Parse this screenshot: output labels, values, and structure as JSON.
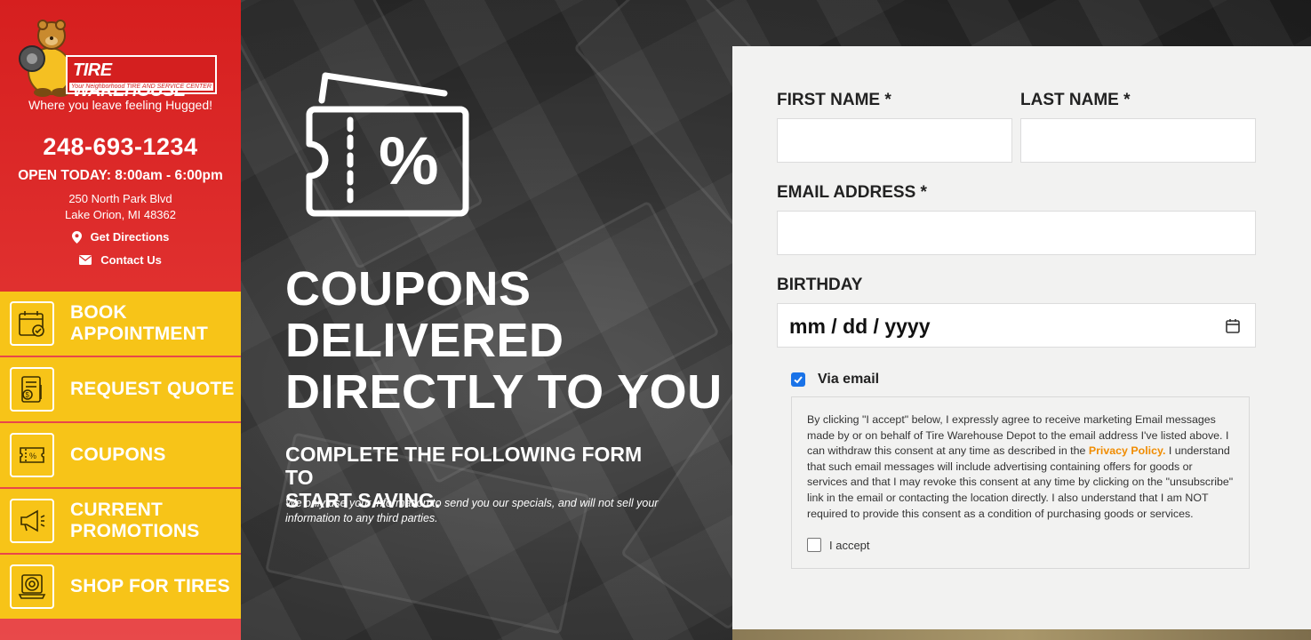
{
  "sidebar": {
    "logo_title": "TIRE WAREHOUSE",
    "logo_subtitle": "Your Neighborhood TIRE AND SERVICE CENTER",
    "tagline": "Where you leave feeling Hugged!",
    "phone": "248-693-1234",
    "hours": "OPEN TODAY: 8:00am - 6:00pm",
    "address_line1": "250 North Park Blvd",
    "address_line2": "Lake Orion, MI 48362",
    "directions_label": "Get Directions",
    "contact_label": "Contact Us",
    "nav": [
      {
        "label_line1": "BOOK",
        "label_line2": "APPOINTMENT",
        "icon": "calendar-check-icon"
      },
      {
        "label_line1": "REQUEST QUOTE",
        "label_line2": "",
        "icon": "calculator-quote-icon"
      },
      {
        "label_line1": "COUPONS",
        "label_line2": "",
        "icon": "coupon-icon"
      },
      {
        "label_line1": "CURRENT",
        "label_line2": "PROMOTIONS",
        "icon": "megaphone-icon"
      },
      {
        "label_line1": "SHOP FOR TIRES",
        "label_line2": "",
        "icon": "tire-laptop-icon"
      }
    ],
    "colors": {
      "red": "#d61f1f",
      "yellow": "#f7c418"
    }
  },
  "hero": {
    "headline_line1": "COUPONS",
    "headline_line2": "DELIVERED",
    "headline_line3": "DIRECTLY TO YOU",
    "subhead_line1": "COMPLETE THE FOLLOWING FORM TO",
    "subhead_line2": "START SAVING.",
    "note_line1": "We only use your information to send you our specials, and will not sell your",
    "note_line2": "information to any third parties.",
    "icon": "coupon-percent-icon"
  },
  "form": {
    "first_name_label": "FIRST NAME *",
    "first_name_value": "",
    "last_name_label": "LAST NAME *",
    "last_name_value": "",
    "email_label": "EMAIL ADDRESS *",
    "email_value": "",
    "birthday_label": "BIRTHDAY",
    "birthday_placeholder": "mm / dd / yyyy",
    "via_email_label": "Via email",
    "via_email_checked": true,
    "consent_part1": "By clicking \"I accept\" below, I expressly agree to receive marketing Email messages made by or on behalf of Tire Warehouse Depot to the email address I've listed above. I can withdraw this consent at any time as described in the ",
    "privacy_link": "Privacy Policy.",
    "consent_part2": " I understand that such email messages will include advertising containing offers for goods or services and that I may revoke this consent at any time by clicking on the \"unsubscribe\" link in the email or contacting the location directly. I also understand that I am NOT required to provide this consent as a condition of purchasing goods or services.",
    "accept_label": "I accept",
    "accept_checked": false,
    "accent_color": "#f08c00",
    "checkbox_color": "#1a73e8"
  }
}
